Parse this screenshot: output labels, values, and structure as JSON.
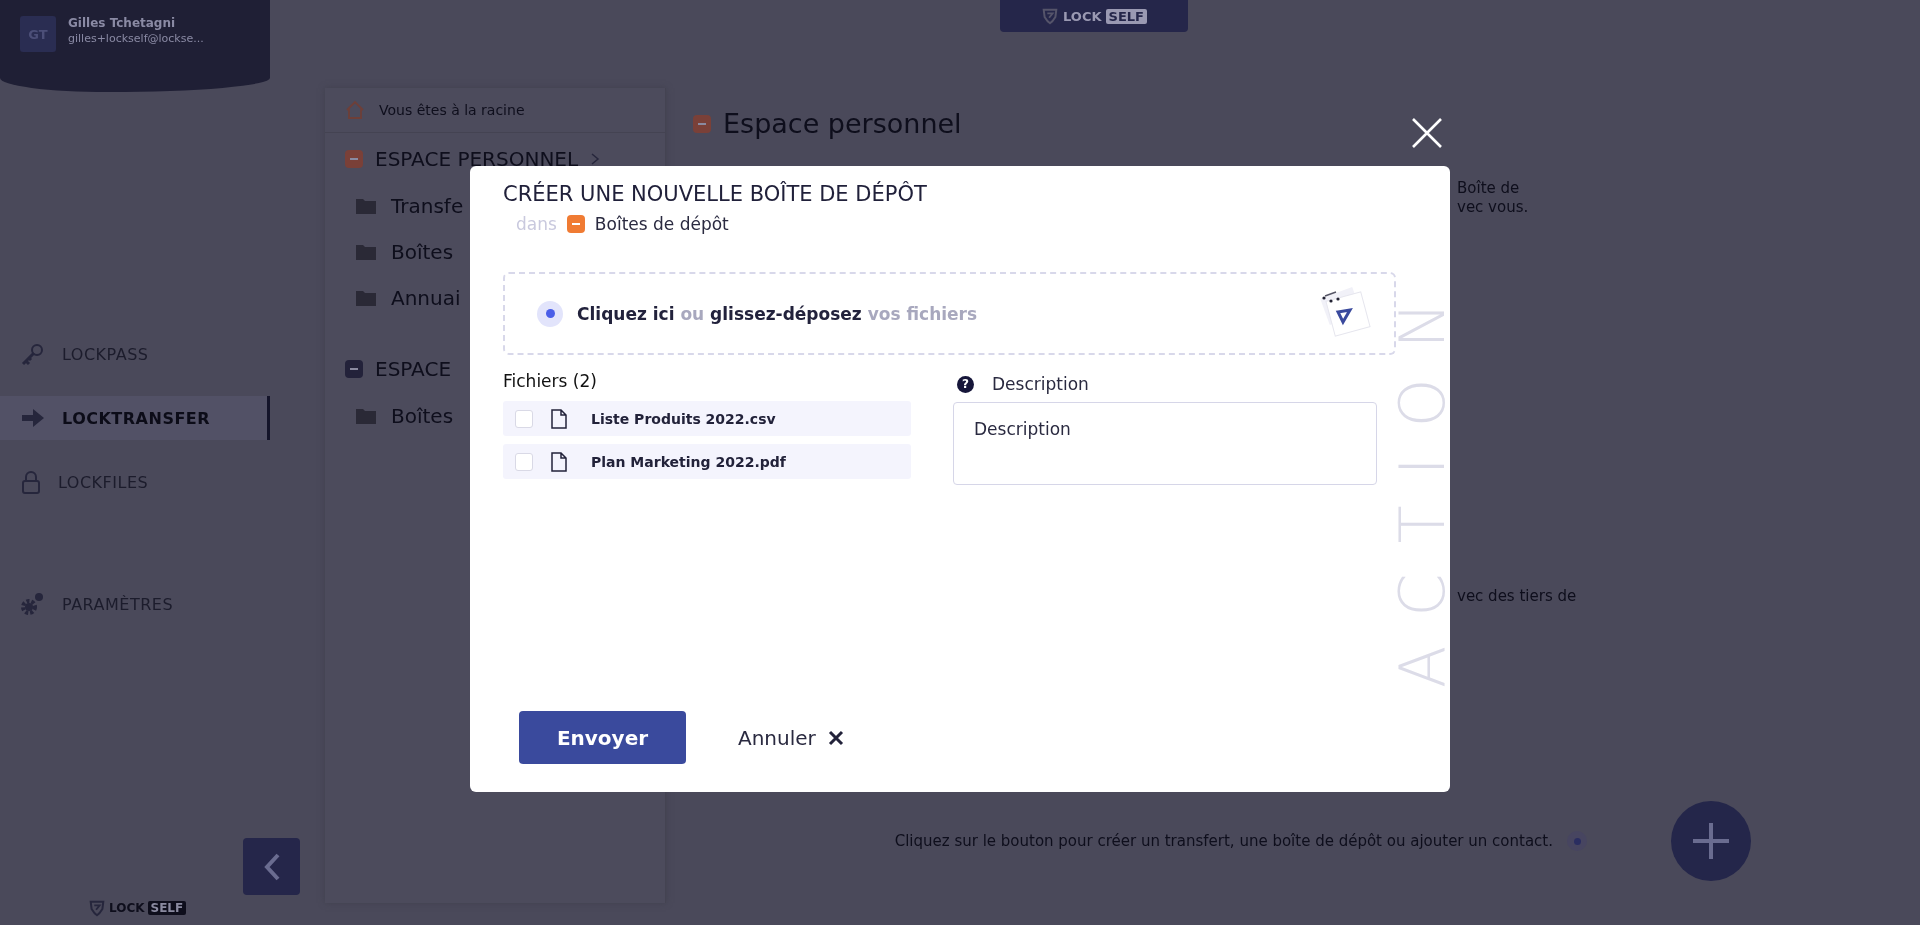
{
  "sidebar": {
    "user": {
      "initials": "GT",
      "name": "Gilles Tchetagni",
      "email": "gilles+lockself@lockse..."
    },
    "nav": [
      {
        "label": "LOCKPASS",
        "kind": "key",
        "selected": false
      },
      {
        "label": "LOCKTRANSFER",
        "kind": "arrow",
        "selected": true
      },
      {
        "label": "LOCKFILES",
        "kind": "lock",
        "selected": false
      },
      {
        "label": "PARAMÈTRES",
        "kind": "gears",
        "selected": false
      }
    ],
    "logo": {
      "word": "LOCK",
      "badge": "SELF"
    }
  },
  "top_logo": {
    "word": "LOCK",
    "badge": "SELF"
  },
  "tree": {
    "breadcrumb": "Vous êtes à la racine",
    "sections": [
      {
        "title": "ESPACE PERSONNEL",
        "color": "#7a4038",
        "children": [
          {
            "label": "Transfe"
          },
          {
            "label": "Boîtes"
          },
          {
            "label": "Annuai"
          }
        ]
      },
      {
        "title": "ESPACE",
        "color": "#23223a",
        "children": [
          {
            "label": "Boîtes"
          }
        ]
      }
    ]
  },
  "content": {
    "title": "Espace personnel",
    "fragments": [
      "Boîte de",
      "vec vous."
    ],
    "fragment_lower": "vec des tiers de",
    "hint": "Cliquez sur le bouton pour créer un transfert, une boîte de dépôt ou ajouter un contact."
  },
  "modal": {
    "title": "CRÉER UNE NOUVELLE BOÎTE DE DÉPÔT",
    "location_prefix": "dans",
    "location": "Boîtes de dépôt",
    "dropzone": "**Cliquez ici** ou **glissez-déposez** vos fichiers",
    "files_heading": "Fichiers (2)",
    "files": [
      {
        "name": "Liste Produits 2022.csv",
        "checked": false
      },
      {
        "name": "Plan Marketing 2022.pdf",
        "checked": false
      }
    ],
    "description": {
      "help_mark": "?",
      "label": "Description",
      "placeholder": "Description"
    },
    "submit": "Envoyer",
    "cancel": "Annuler",
    "watermark": "ACTION"
  }
}
